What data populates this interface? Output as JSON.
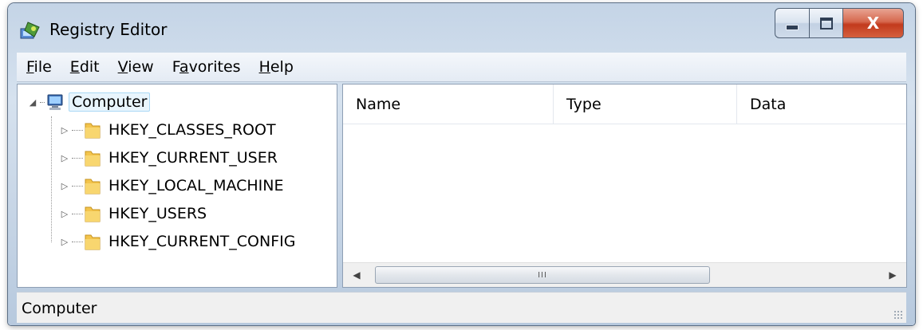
{
  "window": {
    "title": "Registry Editor",
    "controls": {
      "minimize": "minimize",
      "maximize": "maximize",
      "close": "X"
    }
  },
  "menu": [
    {
      "label": "File",
      "accel": "F",
      "rest": "ile"
    },
    {
      "label": "Edit",
      "accel": "E",
      "rest": "dit"
    },
    {
      "label": "View",
      "accel": "V",
      "rest": "iew"
    },
    {
      "label": "Favorites",
      "pre": "F",
      "accel": "a",
      "rest": "vorites"
    },
    {
      "label": "Help",
      "accel": "H",
      "rest": "elp"
    }
  ],
  "tree": {
    "root": "Computer",
    "keys": [
      "HKEY_CLASSES_ROOT",
      "HKEY_CURRENT_USER",
      "HKEY_LOCAL_MACHINE",
      "HKEY_USERS",
      "HKEY_CURRENT_CONFIG"
    ]
  },
  "list": {
    "columns": {
      "name": "Name",
      "type": "Type",
      "data": "Data"
    },
    "scroll_thumb": "III"
  },
  "status": {
    "text": "Computer"
  },
  "colors": {
    "selection_border": "#a9d8f5",
    "close_button": "#c23a1d",
    "folder": "#f3c44c"
  }
}
